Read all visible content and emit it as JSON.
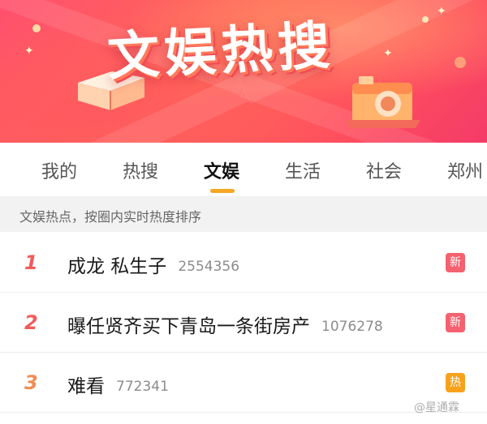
{
  "banner": {
    "title": "文娱热搜"
  },
  "tabs": [
    {
      "label": "我的"
    },
    {
      "label": "热搜"
    },
    {
      "label": "文娱"
    },
    {
      "label": "生活"
    },
    {
      "label": "社会"
    },
    {
      "label": "郑州"
    }
  ],
  "active_tab": "文娱",
  "subheader": "文娱热点，按圈内实时热度排序",
  "items": [
    {
      "rank": "1",
      "title": "成龙 私生子",
      "count": "2554356",
      "badge": "新"
    },
    {
      "rank": "2",
      "title": "曝任贤齐买下青岛一条街房产",
      "count": "1076278",
      "badge": "新"
    },
    {
      "rank": "3",
      "title": "难看",
      "count": "772341",
      "badge": "热"
    }
  ],
  "watermark": "@星通霖",
  "colors": {
    "accent_underline": "#f5a623",
    "badge_new": "#f5616f",
    "badge_hot": "#f7a21b",
    "rank_red": "#f25a5a",
    "rank_orange": "#f08d54"
  }
}
